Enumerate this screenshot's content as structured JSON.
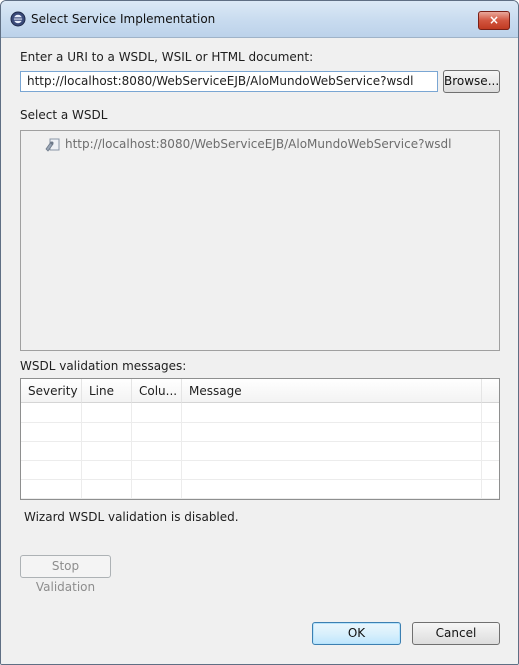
{
  "window": {
    "title": "Select Service Implementation",
    "close_label": "×"
  },
  "uri_section": {
    "label": "Enter a URI to a WSDL, WSIL or HTML document:",
    "value": "http://localhost:8080/WebServiceEJB/AloMundoWebService?wsdl",
    "browse_label": "Browse..."
  },
  "wsdl_section": {
    "label": "Select a WSDL",
    "items": [
      {
        "label": "http://localhost:8080/WebServiceEJB/AloMundoWebService?wsdl",
        "icon": "wsdl-file-icon"
      }
    ]
  },
  "validation": {
    "label": "WSDL validation messages:",
    "columns": [
      "Severity",
      "Line",
      "Colu...",
      "Message"
    ],
    "rows": [],
    "status": "Wizard WSDL validation is disabled.",
    "stop_label": "Stop Validation"
  },
  "footer": {
    "ok_label": "OK",
    "cancel_label": "Cancel"
  }
}
